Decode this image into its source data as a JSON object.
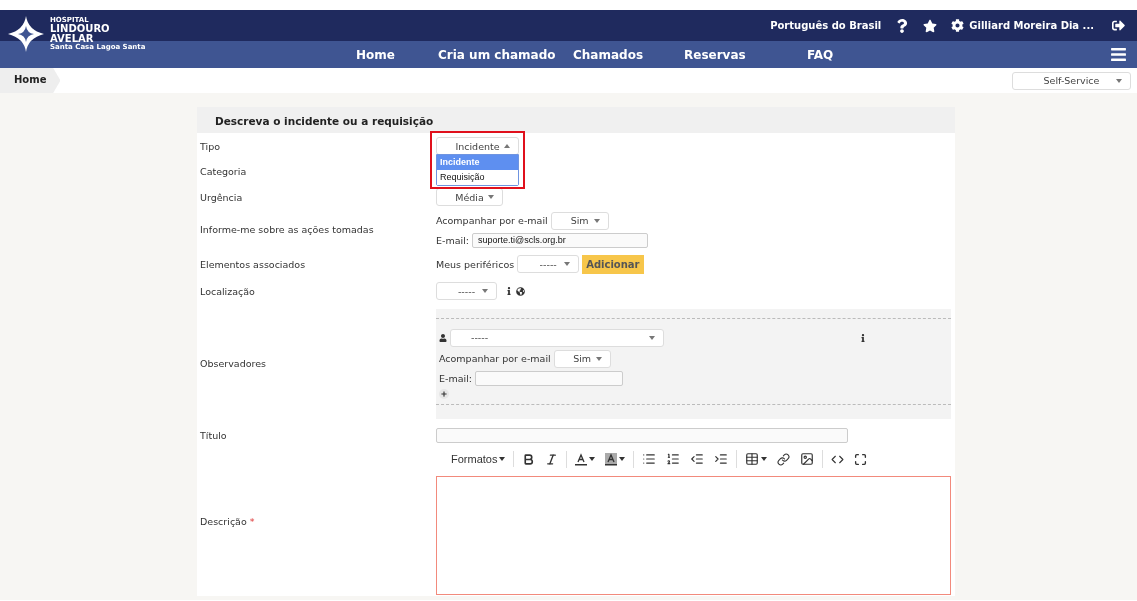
{
  "header": {
    "logo": {
      "line_1": "HOSPITAL",
      "line_2": "LINDOURO",
      "line_3": "AVELAR",
      "tagline": "Santa Casa Lagoa Santa"
    },
    "language": "Português do Brasil",
    "user": "Gilliard Moreira Dia ..."
  },
  "nav": [
    {
      "label": "Home"
    },
    {
      "label": "Cria um chamado"
    },
    {
      "label": "Chamados"
    },
    {
      "label": "Reservas"
    },
    {
      "label": "FAQ"
    }
  ],
  "breadcrumb": "Home",
  "interface_select": "Self-Service",
  "form": {
    "title": "Descreva o incidente ou a requisição",
    "fields": [
      {
        "kind": "dropdown",
        "label": "Tipo",
        "value": "Incidente",
        "open": true,
        "highlighted": true,
        "options": [
          {
            "label": "Incidente",
            "selected": true
          },
          {
            "label": "Requisição",
            "selected": false
          }
        ]
      },
      {
        "kind": "blank",
        "label": "Categoria"
      },
      {
        "kind": "select",
        "label": "Urgência",
        "value": "Média"
      },
      {
        "kind": "notify",
        "label": "Informe-me sobre as ações tomadas",
        "follow_label": "Acompanhar por e-mail",
        "follow_value": "Sim",
        "email_label": "E-mail:",
        "email": "suporte.ti@scls.org.br"
      },
      {
        "kind": "elements",
        "label": "Elementos associados",
        "select_label": "Meus periféricos",
        "value": "-----",
        "button": "Adicionar"
      },
      {
        "kind": "location",
        "label": "Localização",
        "value": "-----"
      },
      {
        "kind": "observers",
        "label": "Observadores",
        "value": "-----",
        "follow_label": "Acompanhar por e-mail",
        "follow_value": "Sim",
        "email_label": "E-mail:"
      },
      {
        "kind": "text",
        "label": "Título"
      },
      {
        "kind": "editor",
        "label": "Descrição",
        "required_mark": "*",
        "formats": "Formatos"
      }
    ]
  }
}
